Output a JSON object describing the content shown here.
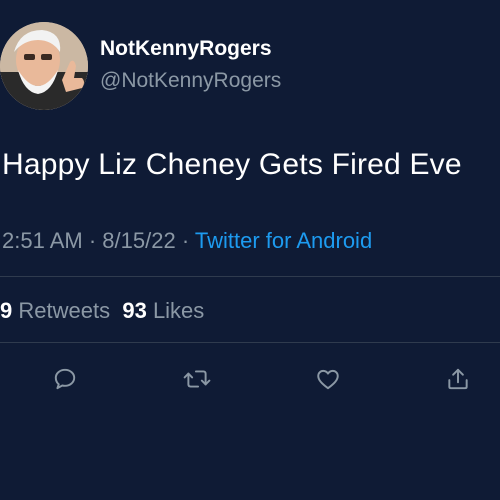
{
  "user": {
    "display_name": "NotKennyRogers",
    "handle": "@NotKennyRogers"
  },
  "tweet": {
    "text": "Happy Liz Cheney Gets Fired Eve",
    "time": "2:51 AM",
    "date": "8/15/22",
    "separator": "·",
    "source": "Twitter for Android"
  },
  "stats": {
    "retweets_count": "9",
    "retweets_label": "Retweets",
    "likes_count": "93",
    "likes_label": "Likes"
  },
  "actions": {
    "reply_icon": "reply-icon",
    "retweet_icon": "retweet-icon",
    "like_icon": "heart-icon",
    "share_icon": "share-icon"
  },
  "colors": {
    "background": "#0f1b35",
    "text_primary": "#ffffff",
    "text_secondary": "#8b98a5",
    "link": "#1d9bf0",
    "divider": "#2f3b4e"
  }
}
